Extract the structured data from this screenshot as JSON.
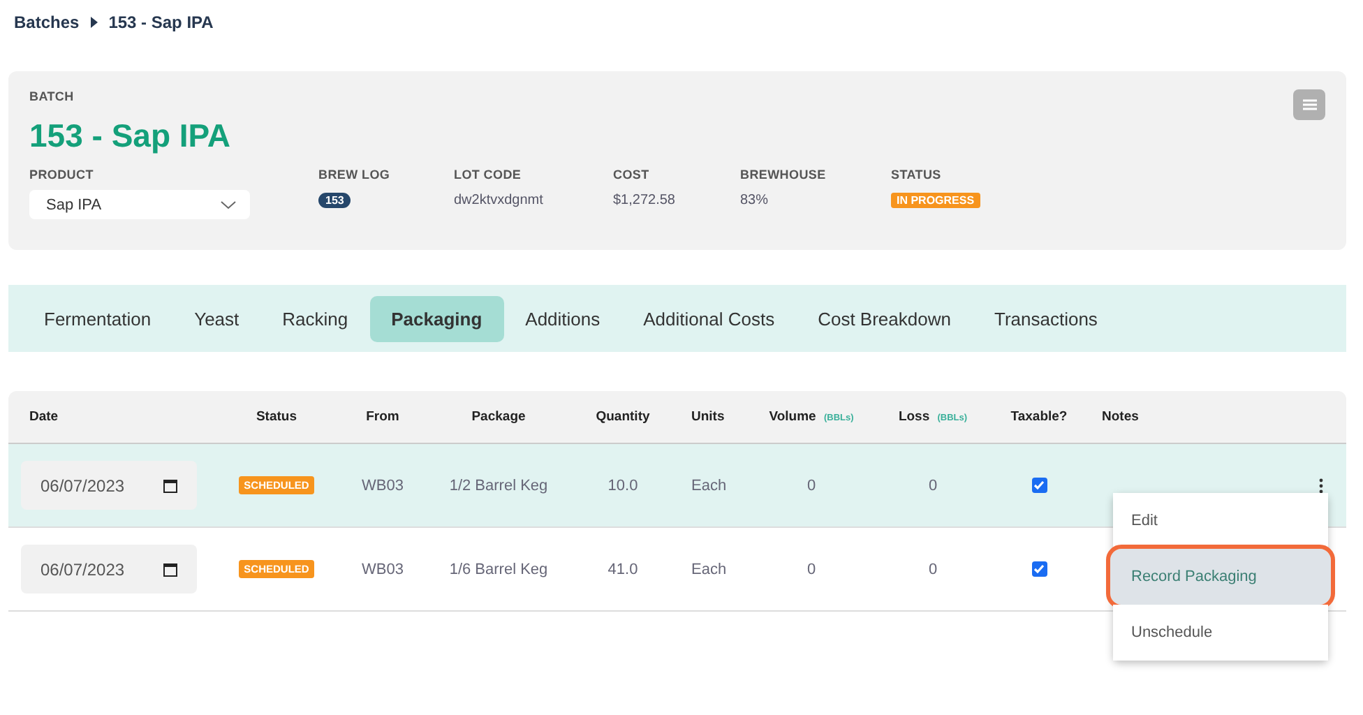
{
  "breadcrumb": {
    "parent": "Batches",
    "current": "153 - Sap IPA"
  },
  "batch": {
    "label": "BATCH",
    "title": "153 - Sap IPA",
    "fields": [
      {
        "kind": "select",
        "label": "PRODUCT",
        "value": "Sap IPA"
      },
      {
        "kind": "pill",
        "label": "BREW LOG",
        "value": "153"
      },
      {
        "kind": "text",
        "label": "LOT CODE",
        "value": "dw2ktvxdgnmt"
      },
      {
        "kind": "text",
        "label": "COST",
        "value": "$1,272.58"
      },
      {
        "kind": "text",
        "label": "BREWHOUSE",
        "value": "83%"
      },
      {
        "kind": "status",
        "label": "STATUS",
        "value": "IN PROGRESS"
      }
    ]
  },
  "tabs": [
    {
      "label": "Fermentation",
      "selected": false
    },
    {
      "label": "Yeast",
      "selected": false
    },
    {
      "label": "Racking",
      "selected": false
    },
    {
      "label": "Packaging",
      "selected": true
    },
    {
      "label": "Additions",
      "selected": false
    },
    {
      "label": "Additional Costs",
      "selected": false
    },
    {
      "label": "Cost Breakdown",
      "selected": false
    },
    {
      "label": "Transactions",
      "selected": false
    }
  ],
  "table": {
    "columns": [
      {
        "label": "Date"
      },
      {
        "label": "Status"
      },
      {
        "label": "From"
      },
      {
        "label": "Package"
      },
      {
        "label": "Quantity"
      },
      {
        "label": "Units"
      },
      {
        "label": "Volume",
        "unit": "(BBLs)"
      },
      {
        "label": "Loss",
        "unit": "(BBLs)"
      },
      {
        "label": "Taxable?"
      },
      {
        "label": "Notes"
      }
    ],
    "rows": [
      {
        "selected": true,
        "date": "06/07/2023",
        "status": "SCHEDULED",
        "from": "WB03",
        "package": "1/2 Barrel Keg",
        "quantity": "10.0",
        "units": "Each",
        "volume": "0",
        "loss": "0",
        "taxable": true,
        "menu_button": true
      },
      {
        "selected": false,
        "date": "06/07/2023",
        "status": "SCHEDULED",
        "from": "WB03",
        "package": "1/6 Barrel Keg",
        "quantity": "41.0",
        "units": "Each",
        "volume": "0",
        "loss": "0",
        "taxable": true,
        "menu_button": false
      }
    ]
  },
  "row_menu": {
    "items": [
      {
        "label": "Edit",
        "selected": false,
        "highlighted": false
      },
      {
        "label": "Record Packaging",
        "selected": true,
        "highlighted": true
      },
      {
        "label": "Unschedule",
        "selected": false,
        "highlighted": false
      }
    ]
  }
}
